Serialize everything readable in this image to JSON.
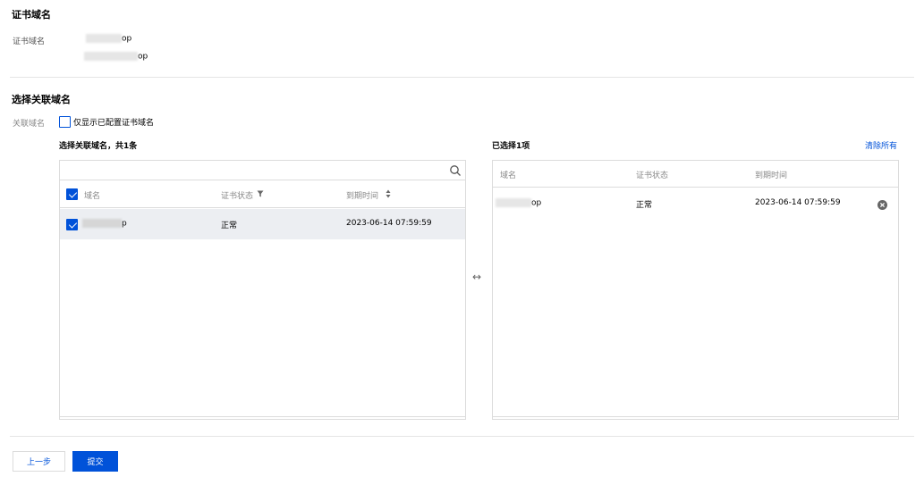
{
  "cert_section": {
    "title": "证书域名",
    "field_label": "证书域名",
    "domain1_suffix": "op",
    "domain2_suffix": "op"
  },
  "assoc_section": {
    "title": "选择关联域名",
    "field_label": "关联域名",
    "filter_checkbox_label": "仅显示已配置证书域名"
  },
  "left_panel": {
    "heading": "选择关联域名，共1条",
    "search_placeholder": "",
    "columns": {
      "domain": "域名",
      "status": "证书状态",
      "expiry": "到期时间"
    },
    "rows": [
      {
        "domain_suffix": "p",
        "status": "正常",
        "expiry": "2023-06-14 07:59:59"
      }
    ]
  },
  "right_panel": {
    "heading": "已选择1项",
    "clear_all": "清除所有",
    "columns": {
      "domain": "域名",
      "status": "证书状态",
      "expiry": "到期时间"
    },
    "rows": [
      {
        "domain_suffix": "op",
        "status": "正常",
        "expiry": "2023-06-14 07:59:59"
      }
    ]
  },
  "transfer_icon": "↔",
  "footer": {
    "prev_label": "上一步",
    "submit_label": "提交"
  },
  "colors": {
    "accent": "#0052d9",
    "border": "#dcdcdc",
    "row_selected": "#eceef2"
  }
}
